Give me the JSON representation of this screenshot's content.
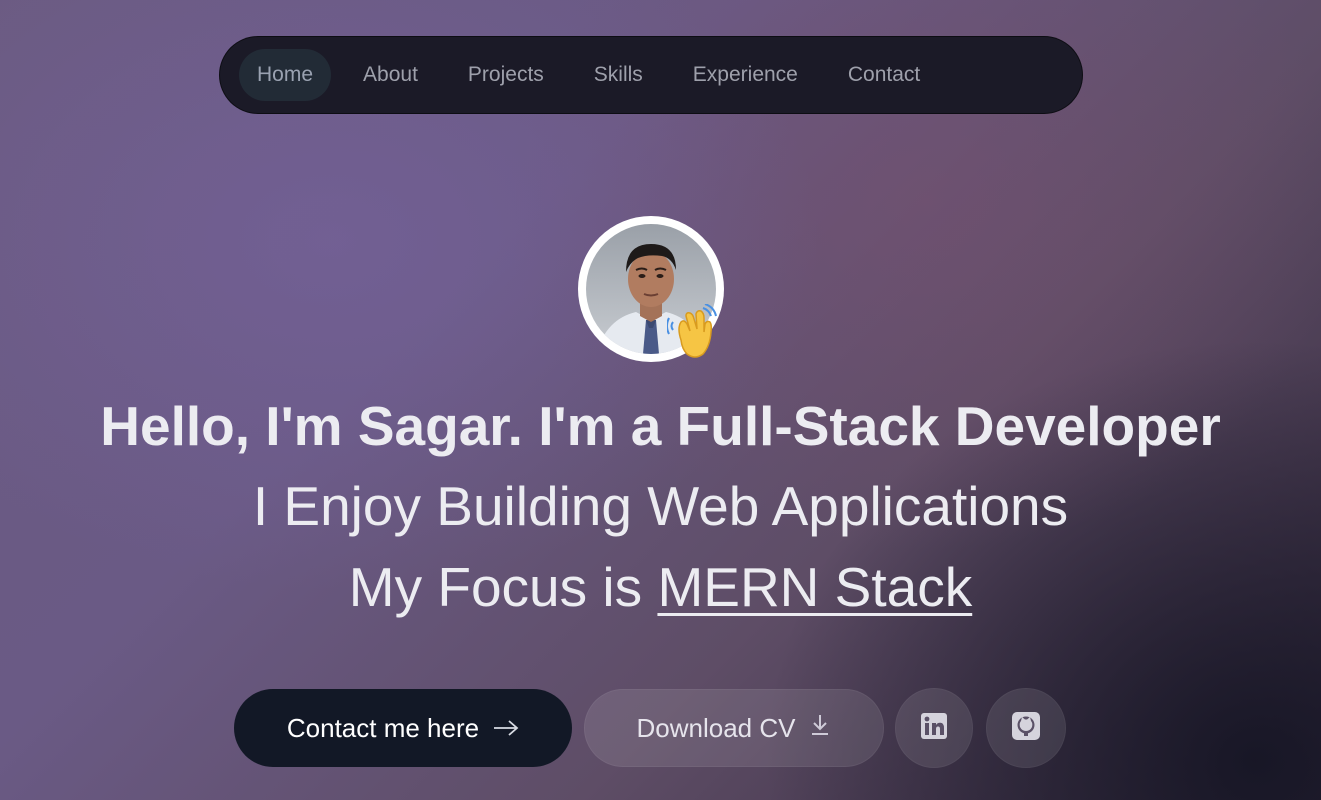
{
  "nav": {
    "items": [
      {
        "label": "Home",
        "active": true
      },
      {
        "label": "About"
      },
      {
        "label": "Projects"
      },
      {
        "label": "Skills"
      },
      {
        "label": "Experience"
      },
      {
        "label": "Contact"
      }
    ]
  },
  "hero": {
    "greeting": "Hello, I'm Sagar.",
    "im_a": " I'm a ",
    "role": "Full-Stack Developer",
    "line2": "I Enjoy Building Web Applications",
    "focus_prefix": "My Focus is ",
    "focus": "MERN Stack"
  },
  "buttons": {
    "contact_label": "Contact me here",
    "cv_label": "Download CV"
  },
  "icons": {
    "avatar": "profile-photo",
    "wave": "waving-hand-icon",
    "contact_arrow": "arrow-right-icon",
    "download": "download-icon",
    "linkedin": "linkedin-icon",
    "github": "github-icon"
  }
}
